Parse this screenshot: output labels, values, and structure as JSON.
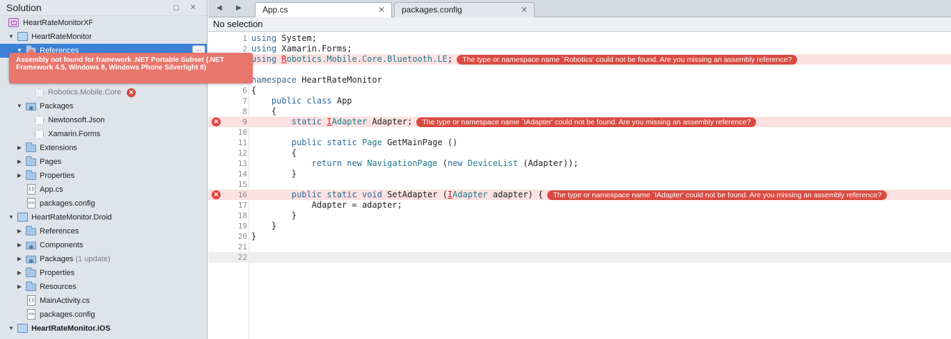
{
  "colors": {
    "accent": "#3c7fd6",
    "error": "#d94b42",
    "tooltip": "#e8766c",
    "error_line": "#fbe1e1"
  },
  "sidebar": {
    "title": "Solution",
    "controls": "◻ ✕",
    "rows": [
      {
        "label": "HeartRateMonitorXF",
        "icon": "solution-icon"
      },
      {
        "label": "HeartRateMonitor",
        "icon": "project-icon"
      },
      {
        "label": "References",
        "icon": "folder-icon",
        "badge": "⋯"
      },
      {
        "label": "Robotics.Mobile.Core",
        "icon": "package-icon"
      },
      {
        "label": "Packages",
        "icon": "folder-icon"
      },
      {
        "label": "Newtonsoft.Json",
        "icon": "package-icon"
      },
      {
        "label": "Xamarin.Forms",
        "icon": "package-icon"
      },
      {
        "label": "Extensions",
        "icon": "folder-icon"
      },
      {
        "label": "Pages",
        "icon": "folder-icon"
      },
      {
        "label": "Properties",
        "icon": "folder-icon"
      },
      {
        "label": "App.cs",
        "icon": "file-icon"
      },
      {
        "label": "packages.config",
        "icon": "file-icon"
      },
      {
        "label": "HeartRateMonitor.Droid",
        "icon": "project-icon"
      },
      {
        "label": "References",
        "icon": "folder-icon"
      },
      {
        "label": "Components",
        "icon": "folder-icon"
      },
      {
        "label": "Packages",
        "icon": "folder-icon",
        "sub": "(1 update)"
      },
      {
        "label": "Properties",
        "icon": "folder-icon"
      },
      {
        "label": "Resources",
        "icon": "folder-icon"
      },
      {
        "label": "MainActivity.cs",
        "icon": "file-icon"
      },
      {
        "label": "packages.config",
        "icon": "file-icon"
      },
      {
        "label": "HeartRateMonitor.iOS",
        "icon": "project-icon"
      }
    ],
    "tooltip": "Assembly not found for framework .NET Portable Subset (.NET Framework 4.5, Windows 8, Windows Phone Silverlight 8)",
    "tree_glyphs": {
      "open": "▼",
      "closed": "▶",
      "file_glyph": "{}",
      "config_glyph": "<>",
      "error_glyph": "✕"
    }
  },
  "editor": {
    "nav_back": "◀",
    "nav_forward": "▶",
    "tabs": [
      {
        "label": "App.cs",
        "close": "✕"
      },
      {
        "label": "packages.config",
        "close": "✕"
      }
    ],
    "path": "No selection",
    "lines": [
      {
        "n": "1",
        "code": "using System;"
      },
      {
        "n": "2",
        "code": "using Xamarin.Forms;"
      },
      {
        "n": "3",
        "code": "using Robotics.Mobile.Core.Bluetooth.LE;",
        "error": "The type or namespace name `Robotics' could not be found. Are you missing an assembly reference?"
      },
      {
        "n": "4",
        "code": ""
      },
      {
        "n": "5",
        "code": "namespace HeartRateMonitor"
      },
      {
        "n": "6",
        "code": "{"
      },
      {
        "n": "7",
        "code": "    public class App"
      },
      {
        "n": "8",
        "code": "    {"
      },
      {
        "n": "9",
        "code": "        static IAdapter Adapter;",
        "error": "The type or namespace name `IAdapter' could not be found. Are you missing an assembly reference?"
      },
      {
        "n": "10",
        "code": ""
      },
      {
        "n": "11",
        "code": "        public static Page GetMainPage ()"
      },
      {
        "n": "12",
        "code": "        {"
      },
      {
        "n": "13",
        "code": "            return new NavigationPage (new DeviceList (Adapter));"
      },
      {
        "n": "14",
        "code": "        }"
      },
      {
        "n": "15",
        "code": ""
      },
      {
        "n": "16",
        "code": "        public static void SetAdapter (IAdapter adapter) {",
        "error": "The type or namespace name `IAdapter' could not be found. Are you missing an assembly reference?"
      },
      {
        "n": "17",
        "code": "            Adapter = adapter;"
      },
      {
        "n": "18",
        "code": "        }"
      },
      {
        "n": "19",
        "code": "    }"
      },
      {
        "n": "20",
        "code": "}"
      },
      {
        "n": "21",
        "code": ""
      },
      {
        "n": "22",
        "code": ""
      }
    ]
  }
}
